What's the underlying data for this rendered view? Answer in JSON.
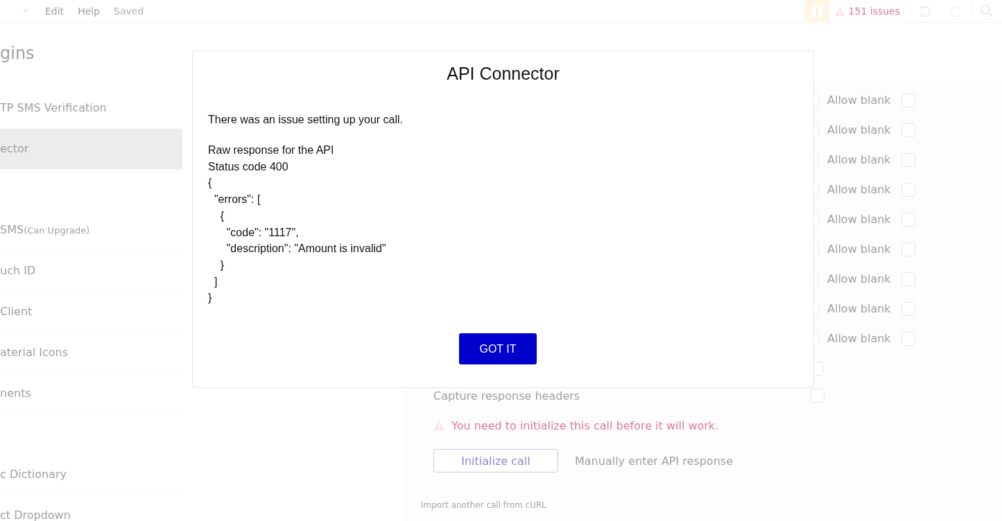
{
  "top_bar": {
    "menu": [
      "Edit",
      "Help"
    ],
    "status": "Saved",
    "issues": "151 issues"
  },
  "sidebar": {
    "heading": "gins",
    "groups": [
      [
        {
          "label": "TP SMS Verification",
          "selected": false
        },
        {
          "label": "ector",
          "selected": true
        }
      ],
      [
        {
          "label": "SMS",
          "note": "(Can Upgrade)",
          "selected": false
        },
        {
          "label": "uch ID",
          "selected": false
        },
        {
          "label": "Client",
          "selected": false
        },
        {
          "label": "aterial Icons",
          "selected": false
        },
        {
          "label": "nents",
          "selected": false
        }
      ],
      [
        {
          "label": "c Dictionary",
          "selected": false
        },
        {
          "label": "ct Dropdown",
          "selected": false
        }
      ]
    ]
  },
  "api_panel": {
    "allow_blank_rows": [
      {
        "option_checked": false,
        "label": "Allow blank",
        "checked": false
      },
      {
        "option_checked": false,
        "label": "Allow blank",
        "checked": false
      },
      {
        "option_checked": false,
        "label": "Allow blank",
        "checked": false
      },
      {
        "option_checked": false,
        "label": "Allow blank",
        "checked": false
      },
      {
        "option_checked": false,
        "label": "Allow blank",
        "checked": false
      },
      {
        "option_checked": false,
        "label": "Allow blank",
        "checked": false
      },
      {
        "option_checked": false,
        "label": "Allow blank",
        "checked": false
      },
      {
        "option_checked": false,
        "label": "Allow blank",
        "checked": false
      },
      {
        "option_checked": false,
        "label": "Allow blank",
        "checked": false
      }
    ],
    "extra_checkbox": {
      "checked": false
    },
    "capture_headers": {
      "label": "Capture response headers",
      "checked": false
    },
    "warning": "You need to initialize this call before it will work.",
    "initialize_button": "Initialize call",
    "manual_link": "Manually enter API response",
    "import_link": "Import another call from cURL"
  },
  "modal": {
    "title": "API Connector",
    "message": "There was an issue setting up your call.",
    "response_lines": [
      "Raw response for the API",
      "Status code 400",
      "{",
      "  \"errors\": [",
      "    {",
      "      \"code\": \"1117\",",
      "      \"description\": \"Amount is invalid\"",
      "    }",
      "  ]",
      "}"
    ],
    "button": "GOT IT"
  }
}
